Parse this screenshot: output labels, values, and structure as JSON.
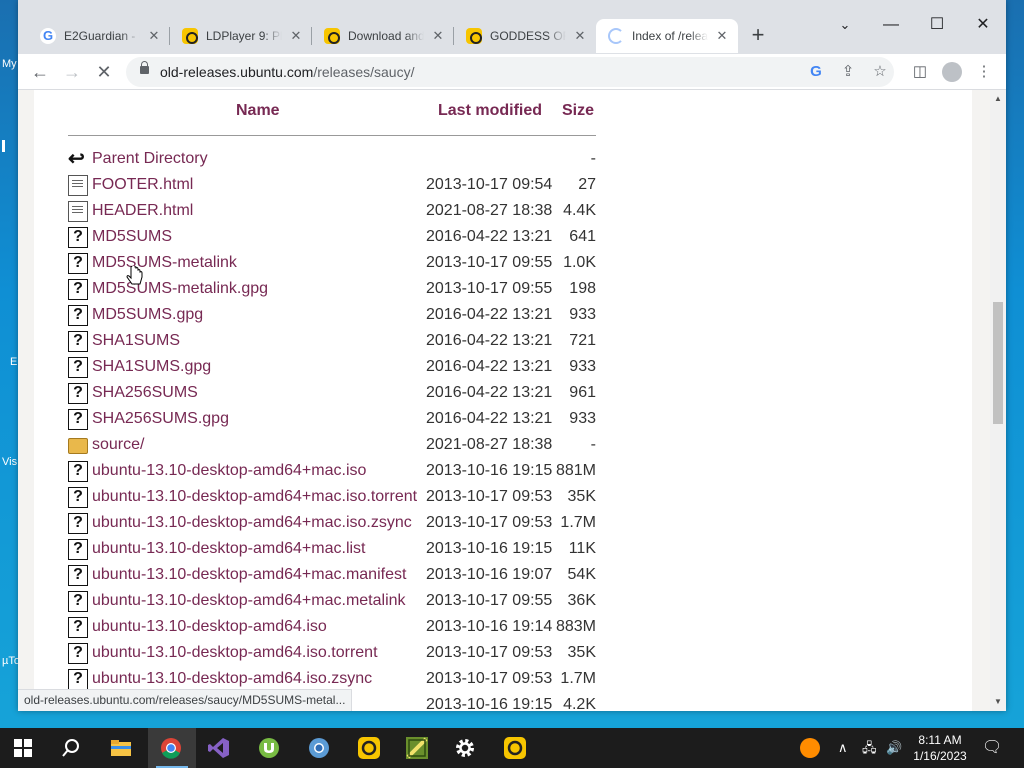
{
  "desktop": {
    "icon_labels": [
      "My",
      "E",
      "Vis",
      "µTo"
    ]
  },
  "browser": {
    "tabs": [
      {
        "title": "E2Guardian - U",
        "favicon": "google-icon"
      },
      {
        "title": "LDPlayer 9: Pla",
        "favicon": "ldplayer-icon"
      },
      {
        "title": "Download and",
        "favicon": "ldplayer-icon"
      },
      {
        "title": "GODDESS OF",
        "favicon": "ldplayer-icon"
      },
      {
        "title": "Index of /relea",
        "favicon": "loading-icon",
        "active": true
      }
    ],
    "new_tab": "+",
    "url_host": "old-releases.ubuntu.com",
    "url_path": "/releases/saucy/",
    "status_text": "old-releases.ubuntu.com/releases/saucy/MD5SUMS-metal..."
  },
  "listing": {
    "headers": {
      "name": "Name",
      "modified": "Last modified",
      "size": "Size"
    },
    "rows": [
      {
        "icon": "back-icon",
        "name": "Parent Directory",
        "modified": "",
        "size": "-"
      },
      {
        "icon": "text-file-icon",
        "name": "FOOTER.html",
        "modified": "2013-10-17 09:54",
        "size": "27"
      },
      {
        "icon": "text-file-icon",
        "name": "HEADER.html",
        "modified": "2021-08-27 18:38",
        "size": "4.4K"
      },
      {
        "icon": "unknown-file-icon",
        "name": "MD5SUMS",
        "modified": "2016-04-22 13:21",
        "size": "641"
      },
      {
        "icon": "unknown-file-icon",
        "name": "MD5SUMS-metalink",
        "modified": "2013-10-17 09:55",
        "size": "1.0K"
      },
      {
        "icon": "unknown-file-icon",
        "name": "MD5SUMS-metalink.gpg",
        "modified": "2013-10-17 09:55",
        "size": "198"
      },
      {
        "icon": "unknown-file-icon",
        "name": "MD5SUMS.gpg",
        "modified": "2016-04-22 13:21",
        "size": "933"
      },
      {
        "icon": "unknown-file-icon",
        "name": "SHA1SUMS",
        "modified": "2016-04-22 13:21",
        "size": "721"
      },
      {
        "icon": "unknown-file-icon",
        "name": "SHA1SUMS.gpg",
        "modified": "2016-04-22 13:21",
        "size": "933"
      },
      {
        "icon": "unknown-file-icon",
        "name": "SHA256SUMS",
        "modified": "2016-04-22 13:21",
        "size": "961"
      },
      {
        "icon": "unknown-file-icon",
        "name": "SHA256SUMS.gpg",
        "modified": "2016-04-22 13:21",
        "size": "933"
      },
      {
        "icon": "folder-icon",
        "name": "source/",
        "modified": "2021-08-27 18:38",
        "size": "-"
      },
      {
        "icon": "unknown-file-icon",
        "name": "ubuntu-13.10-desktop-amd64+mac.iso",
        "modified": "2013-10-16 19:15",
        "size": "881M"
      },
      {
        "icon": "unknown-file-icon",
        "name": "ubuntu-13.10-desktop-amd64+mac.iso.torrent",
        "modified": "2013-10-17 09:53",
        "size": "35K"
      },
      {
        "icon": "unknown-file-icon",
        "name": "ubuntu-13.10-desktop-amd64+mac.iso.zsync",
        "modified": "2013-10-17 09:53",
        "size": "1.7M"
      },
      {
        "icon": "unknown-file-icon",
        "name": "ubuntu-13.10-desktop-amd64+mac.list",
        "modified": "2013-10-16 19:15",
        "size": "11K"
      },
      {
        "icon": "unknown-file-icon",
        "name": "ubuntu-13.10-desktop-amd64+mac.manifest",
        "modified": "2013-10-16 19:07",
        "size": "54K"
      },
      {
        "icon": "unknown-file-icon",
        "name": "ubuntu-13.10-desktop-amd64+mac.metalink",
        "modified": "2013-10-17 09:55",
        "size": "36K"
      },
      {
        "icon": "unknown-file-icon",
        "name": "ubuntu-13.10-desktop-amd64.iso",
        "modified": "2013-10-16 19:14",
        "size": "883M"
      },
      {
        "icon": "unknown-file-icon",
        "name": "ubuntu-13.10-desktop-amd64.iso.torrent",
        "modified": "2013-10-17 09:53",
        "size": "35K"
      },
      {
        "icon": "unknown-file-icon",
        "name": "ubuntu-13.10-desktop-amd64.iso.zsync",
        "modified": "2013-10-17 09:53",
        "size": "1.7M"
      },
      {
        "icon": "unknown-file-icon",
        "name": "",
        "modified": "2013-10-16 19:15",
        "size": "4.2K"
      }
    ]
  },
  "taskbar": {
    "apps": [
      "start-icon",
      "search-icon",
      "file-explorer-icon",
      "chrome-icon",
      "visual-studio-icon",
      "utorrent-icon",
      "chromium-icon",
      "ldplayer-icon",
      "app-icon",
      "settings-icon",
      "ldplayer-icon"
    ],
    "time": "8:11 AM",
    "date": "1/16/2023"
  },
  "colors": {
    "link": "#772953",
    "taskbar": "#1c1c1c",
    "tab_strip": "#dee1e6"
  }
}
